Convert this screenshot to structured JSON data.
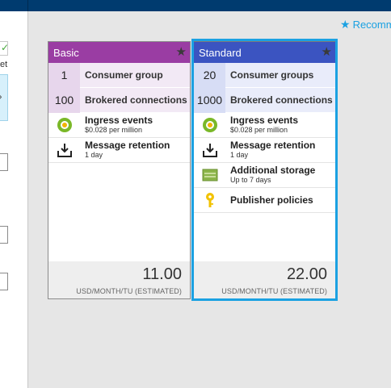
{
  "left_panel": {
    "partial_text": "et"
  },
  "recommend": {
    "label": "Recomm"
  },
  "tiers": {
    "basic": {
      "name": "Basic",
      "header_color": "#9a3da3",
      "quantities": [
        {
          "value": "1",
          "label": "Consumer group"
        },
        {
          "value": "100",
          "label": "Brokered connections"
        }
      ],
      "features": [
        {
          "icon": "ingress-events-icon",
          "title": "Ingress events",
          "subtitle": "$0.028 per million"
        },
        {
          "icon": "message-retention-icon",
          "title": "Message retention",
          "subtitle": "1 day"
        }
      ],
      "price": "11.00",
      "unit": "USD/MONTH/TU (ESTIMATED)"
    },
    "standard": {
      "name": "Standard",
      "header_color": "#3b54c1",
      "selected": true,
      "quantities": [
        {
          "value": "20",
          "label": "Consumer groups"
        },
        {
          "value": "1000",
          "label": "Brokered connections"
        }
      ],
      "features": [
        {
          "icon": "ingress-events-icon",
          "title": "Ingress events",
          "subtitle": "$0.028 per million"
        },
        {
          "icon": "message-retention-icon",
          "title": "Message retention",
          "subtitle": "1 day"
        },
        {
          "icon": "additional-storage-icon",
          "title": "Additional storage",
          "subtitle": "Up to 7 days"
        },
        {
          "icon": "publisher-policies-icon",
          "title": "Publisher policies",
          "subtitle": ""
        }
      ],
      "price": "22.00",
      "unit": "USD/MONTH/TU (ESTIMATED)"
    }
  },
  "colors": {
    "accent": "#1ba1e2",
    "topbar": "#003b6f"
  }
}
